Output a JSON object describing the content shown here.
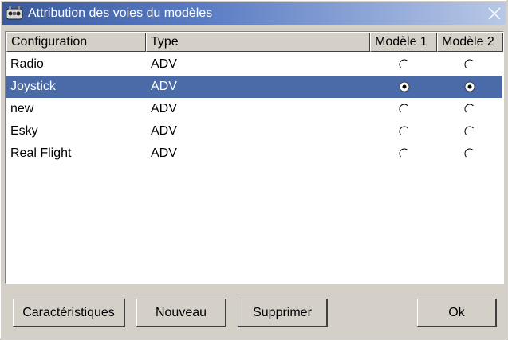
{
  "window": {
    "title": "Attribution des voies du modèles",
    "app_icon": "joystick-app-icon",
    "close_icon": "close-x-icon"
  },
  "table": {
    "columns": [
      "Configuration",
      "Type",
      "Modèle 1",
      "Modèle 2"
    ],
    "rows": [
      {
        "configuration": "Radio",
        "type": "ADV",
        "modele1": false,
        "modele2": false,
        "selected": false
      },
      {
        "configuration": "Joystick",
        "type": "ADV",
        "modele1": true,
        "modele2": true,
        "selected": true
      },
      {
        "configuration": "new",
        "type": "ADV",
        "modele1": false,
        "modele2": false,
        "selected": false
      },
      {
        "configuration": "Esky",
        "type": "ADV",
        "modele1": false,
        "modele2": false,
        "selected": false
      },
      {
        "configuration": "Real Flight",
        "type": "ADV",
        "modele1": false,
        "modele2": false,
        "selected": false
      }
    ]
  },
  "buttons": {
    "characteristics": "Caractéristiques",
    "new": "Nouveau",
    "delete": "Supprimer",
    "ok": "Ok"
  },
  "colors": {
    "selection": "#4a6aa8",
    "titlebar": "#3a5a9c",
    "face": "#d4d0c8"
  }
}
